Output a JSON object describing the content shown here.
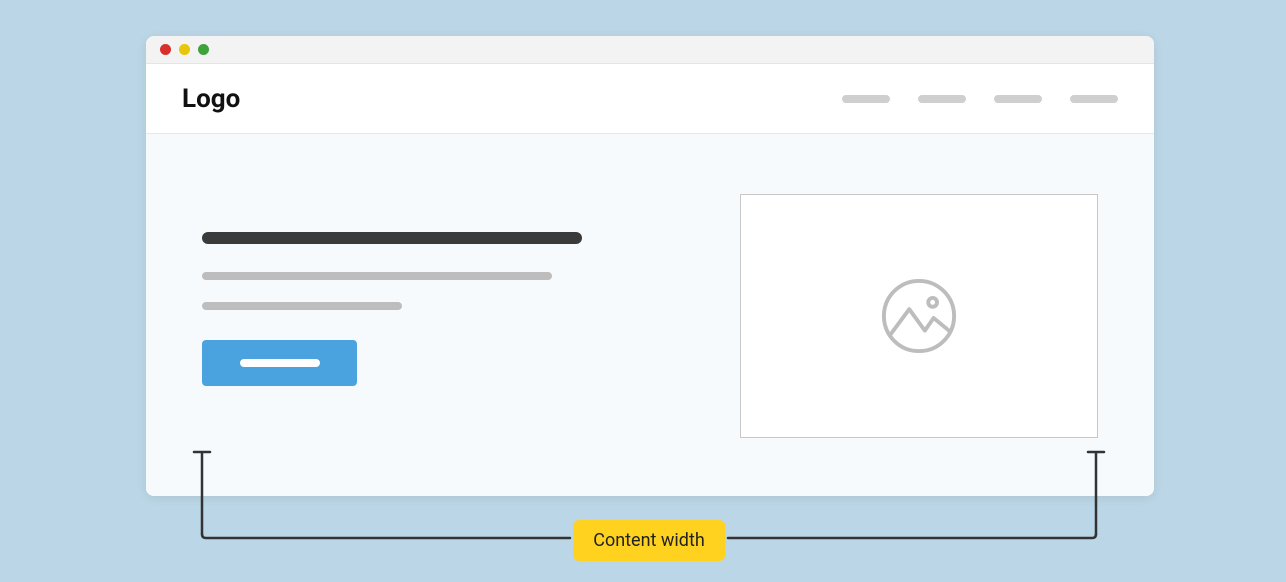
{
  "header": {
    "logo": "Logo"
  },
  "annotation": {
    "label": "Content width"
  }
}
